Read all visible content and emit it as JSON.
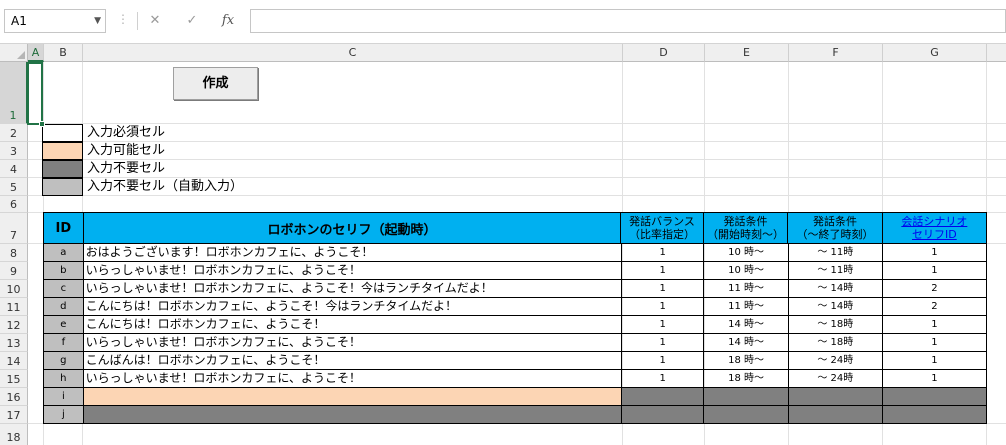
{
  "formula_bar": {
    "name_box": "A1",
    "cancel_icon": "✕",
    "enter_icon": "✓",
    "fx_label": "fx",
    "formula": ""
  },
  "columns": [
    "A",
    "B",
    "C",
    "D",
    "E",
    "F",
    "G"
  ],
  "rows": [
    "1",
    "2",
    "3",
    "4",
    "5",
    "6",
    "7",
    "8",
    "9",
    "10",
    "11",
    "12",
    "13",
    "14",
    "15",
    "16",
    "17",
    "18"
  ],
  "create_button": "作成",
  "legend": [
    {
      "label": "入力必須セル",
      "color": "#ffffff"
    },
    {
      "label": "入力可能セル",
      "color": "#fcd5b4"
    },
    {
      "label": "入力不要セル",
      "color": "#808080"
    },
    {
      "label": "入力不要セル（自動入力）",
      "color": "#bfbfbf"
    }
  ],
  "table": {
    "headers": {
      "id": "ID",
      "line": "ロボホンのセリフ（起動時）",
      "balance_1": "発話バランス",
      "balance_2": "（比率指定）",
      "start_1": "発話条件",
      "start_2": "（開始時刻～）",
      "end_1": "発話条件",
      "end_2": "（～終了時刻）",
      "scenario_1": "会話シナリオ",
      "scenario_2": "セリフID"
    },
    "rows": [
      {
        "id": "a",
        "line": "おはようございます！ロボホンカフェに、ようこそ！",
        "balance": "1",
        "start": "10 時～",
        "end": "～ 11時",
        "scenario": "1"
      },
      {
        "id": "b",
        "line": "いらっしゃいませ！ロボホンカフェに、ようこそ！",
        "balance": "1",
        "start": "10 時～",
        "end": "～ 11時",
        "scenario": "1"
      },
      {
        "id": "c",
        "line": "いらっしゃいませ！ロボホンカフェに、ようこそ！今はランチタイムだよ！",
        "balance": "1",
        "start": "11 時～",
        "end": "～ 14時",
        "scenario": "2"
      },
      {
        "id": "d",
        "line": "こんにちは！ロボホンカフェに、ようこそ！今はランチタイムだよ！",
        "balance": "1",
        "start": "11 時～",
        "end": "～ 14時",
        "scenario": "2"
      },
      {
        "id": "e",
        "line": "こんにちは！ロボホンカフェに、ようこそ！",
        "balance": "1",
        "start": "14 時～",
        "end": "～ 18時",
        "scenario": "1"
      },
      {
        "id": "f",
        "line": "いらっしゃいませ！ロボホンカフェに、ようこそ！",
        "balance": "1",
        "start": "14 時～",
        "end": "～ 18時",
        "scenario": "1"
      },
      {
        "id": "g",
        "line": "こんばんは！ロボホンカフェに、ようこそ！",
        "balance": "1",
        "start": "18 時～",
        "end": "～ 24時",
        "scenario": "1"
      },
      {
        "id": "h",
        "line": "いらっしゃいませ！ロボホンカフェに、ようこそ！",
        "balance": "1",
        "start": "18 時～",
        "end": "～ 24時",
        "scenario": "1"
      },
      {
        "id": "i",
        "line": "",
        "balance": "",
        "start": "",
        "end": "",
        "scenario": ""
      },
      {
        "id": "j",
        "line": "",
        "balance": "",
        "start": "",
        "end": "",
        "scenario": ""
      }
    ]
  },
  "colors": {
    "header_blue": "#00b0f0",
    "peach": "#fcd5b4",
    "dark_gray": "#808080",
    "light_gray": "#bfbfbf",
    "excel_green": "#217346"
  }
}
